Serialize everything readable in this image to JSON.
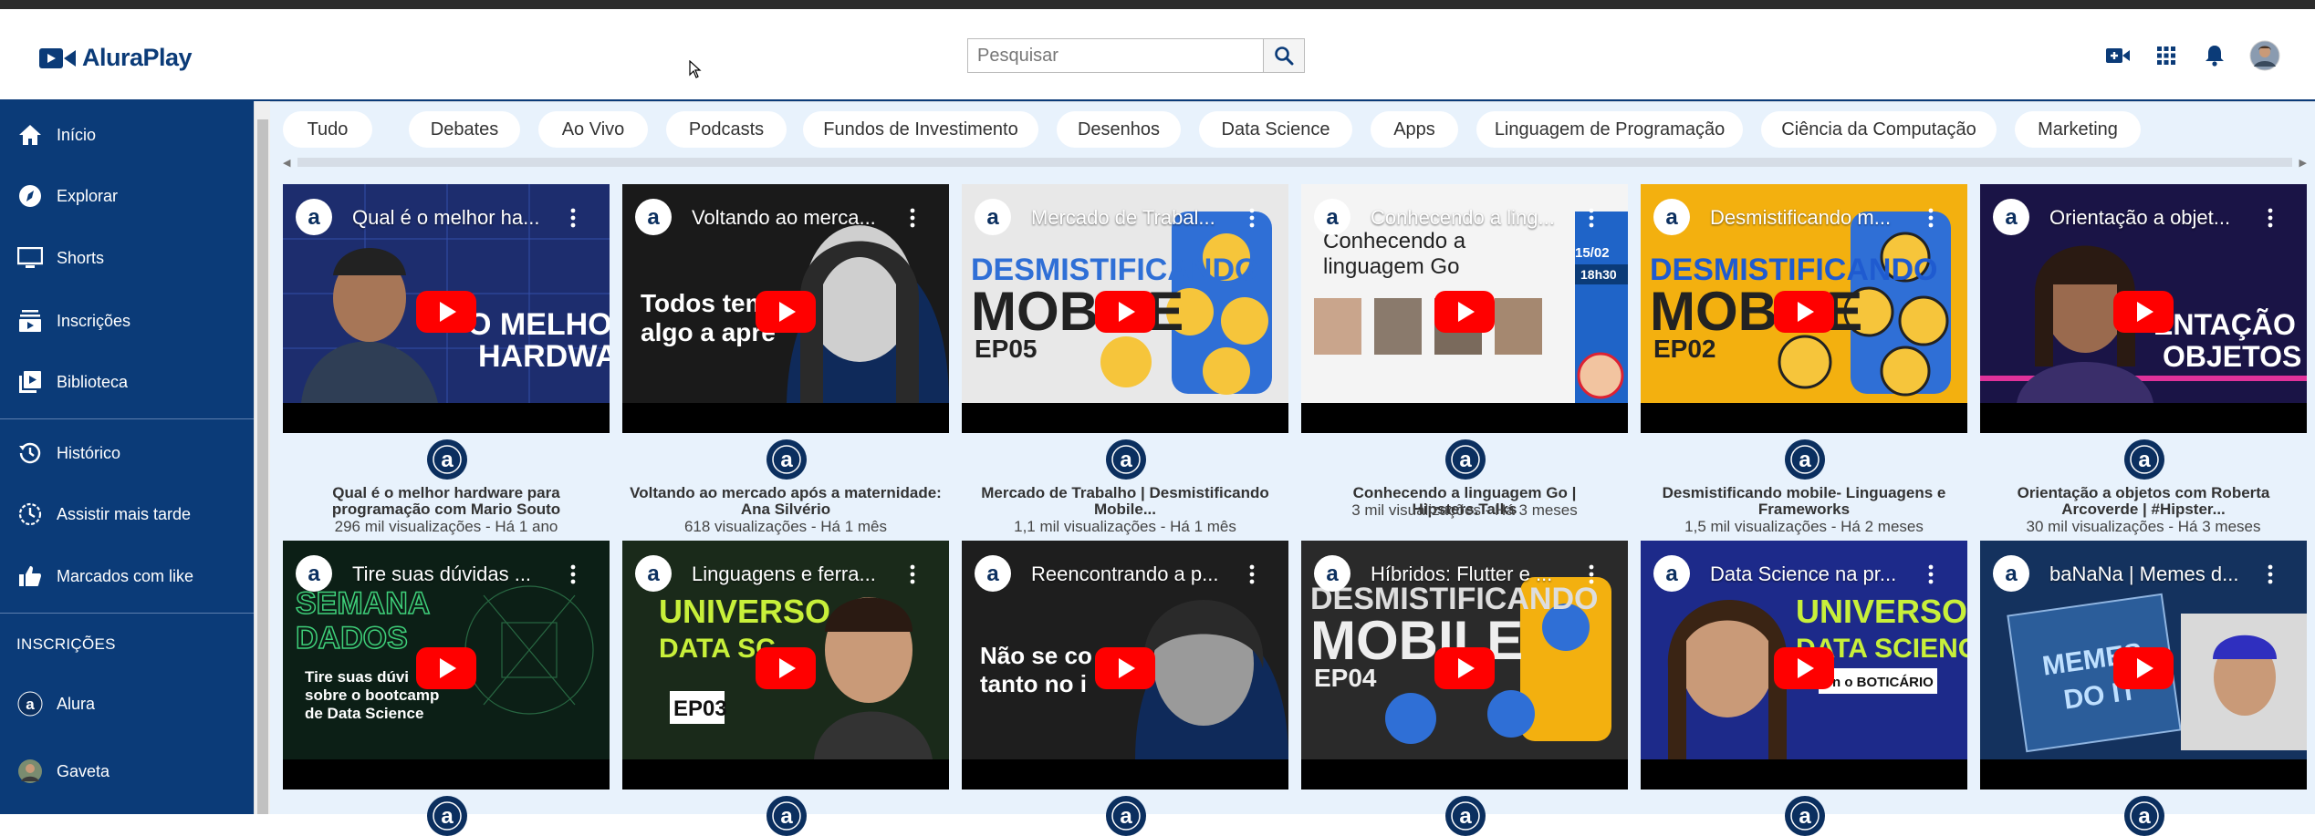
{
  "app": {
    "name": "AluraPlay"
  },
  "search": {
    "placeholder": "Pesquisar"
  },
  "header_icons": [
    "add-video-icon",
    "apps-grid-icon",
    "bell-icon",
    "avatar"
  ],
  "colors": {
    "brand": "#0b3b78",
    "bg": "#e8f2fc",
    "play": "#ff0000"
  },
  "sidebar": {
    "items": [
      {
        "label": "Início",
        "icon": "home-icon"
      },
      {
        "label": "Explorar",
        "icon": "compass-icon"
      },
      {
        "label": "Shorts",
        "icon": "monitor-icon"
      },
      {
        "label": "Inscrições",
        "icon": "subscriptions-icon"
      },
      {
        "label": "Biblioteca",
        "icon": "library-icon"
      },
      {
        "label": "Histórico",
        "icon": "history-icon"
      },
      {
        "label": "Assistir mais tarde",
        "icon": "clock-icon"
      },
      {
        "label": "Marcados com like",
        "icon": "thumbs-up-icon"
      }
    ],
    "section_title": "INSCRIÇÕES",
    "subscriptions": [
      {
        "label": "Alura",
        "icon": "alura-logo-icon"
      },
      {
        "label": "Gaveta",
        "icon": "avatar"
      }
    ]
  },
  "chips": [
    "Tudo",
    "Debates",
    "Ao Vivo",
    "Podcasts",
    "Fundos de Investimento",
    "Desenhos",
    "Data Science",
    "Apps",
    "Linguagem de Programação",
    "Ciência da Computação",
    "Marketing"
  ],
  "videos": [
    {
      "thumb_title": "Qual é o melhor ha...",
      "title": "Qual é o melhor hardware para programação com Mario Souto",
      "meta": "296 mil visualizações - Há 1 ano"
    },
    {
      "thumb_title": "Voltando ao merca...",
      "title": "Voltando ao mercado após a maternidade: Ana Silvério",
      "meta": "618 visualizações - Há 1 mês"
    },
    {
      "thumb_title": "Mercado de Trabal...",
      "title": "Mercado de Trabalho | Desmistificando Mobile...",
      "meta": "1,1 mil visualizações - Há 1 mês"
    },
    {
      "thumb_title": "Conhecendo a ling...",
      "title": "Conhecendo a linguagem Go | Hipsters.Talks",
      "meta": "3 mil visualizações - Há 3 meses"
    },
    {
      "thumb_title": "Desmistificando m...",
      "title": "Desmistificando mobile- Linguagens e Frameworks",
      "meta": "1,5 mil visualizações - Há 2 meses"
    },
    {
      "thumb_title": "Orientação a objet...",
      "title": "Orientação a objetos com Roberta Arcoverde | #Hipster...",
      "meta": "30 mil visualizações - Há 3 meses"
    },
    {
      "thumb_title": "Tire suas dúvidas ..."
    },
    {
      "thumb_title": "Linguagens e ferra..."
    },
    {
      "thumb_title": "Reencontrando a p..."
    },
    {
      "thumb_title": "Híbridos: Flutter e ..."
    },
    {
      "thumb_title": "Data Science na pr..."
    },
    {
      "thumb_title": "baNaNa | Memes d..."
    }
  ]
}
